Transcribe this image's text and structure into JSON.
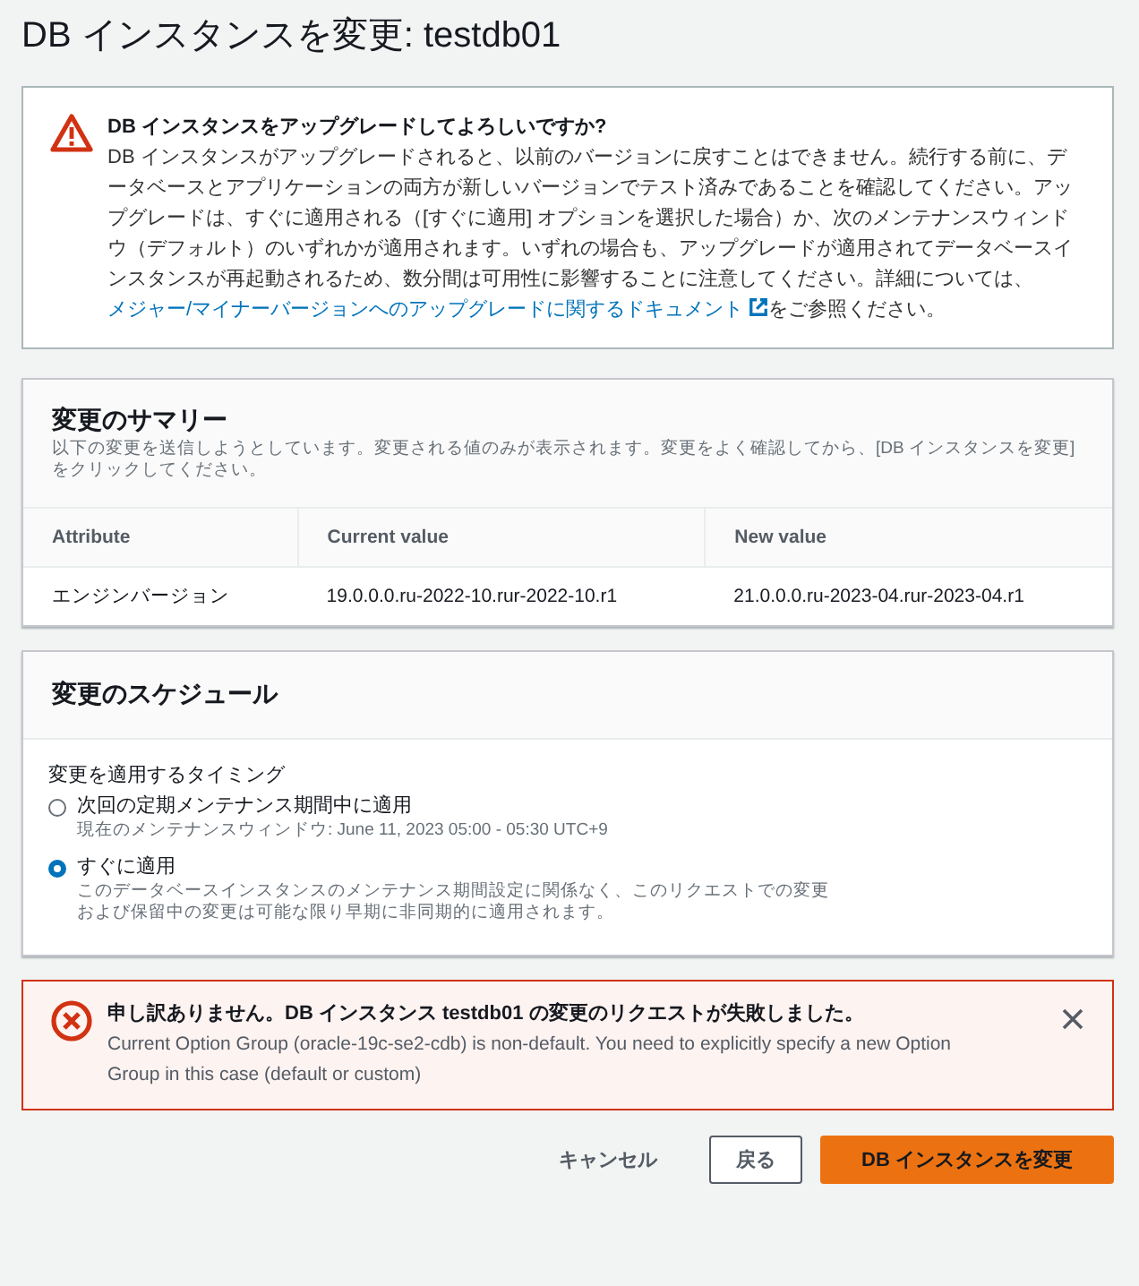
{
  "page_title": "DB インスタンスを変更: testdb01",
  "warning": {
    "title": "DB インスタンスをアップグレードしてよろしいですか?",
    "text_before": "DB インスタンスがアップグレードされると、以前のバージョンに戻すことはできません。続行する前に、データベースとアプリケーションの両方が新しいバージョンでテスト済みであることを確認してください。アップグレードは、すぐに適用される（[すぐに適用] オプションを選択した場合）か、次のメンテナンスウィンドウ（デフォルト）のいずれかが適用されます。いずれの場合も、アップグレードが適用されてデータベースインスタンスが再起動されるため、数分間は可用性に影響することに注意してください。詳細については、",
    "link": "メジャー/マイナーバージョンへのアップグレードに関するドキュメント",
    "text_after": "をご参照ください。"
  },
  "summary": {
    "title": "変更のサマリー",
    "description": "以下の変更を送信しようとしています。変更される値のみが表示されます。変更をよく確認してから、[DB インスタンスを変更] をクリックしてください。",
    "columns": [
      "Attribute",
      "Current value",
      "New value"
    ],
    "rows": [
      [
        "エンジンバージョン",
        "19.0.0.0.ru-2022-10.rur-2022-10.r1",
        "21.0.0.0.ru-2023-04.rur-2023-04.r1"
      ]
    ]
  },
  "schedule": {
    "title": "変更のスケジュール",
    "label": "変更を適用するタイミング",
    "options": [
      {
        "label": "次回の定期メンテナンス期間中に適用",
        "description": "現在のメンテナンスウィンドウ: June 11, 2023 05:00 - 05:30 UTC+9",
        "selected": false
      },
      {
        "label": "すぐに適用",
        "description": "このデータベースインスタンスのメンテナンス期間設定に関係なく、このリクエストでの変更および保留中の変更は可能な限り早期に非同期的に適用されます。",
        "selected": true
      }
    ]
  },
  "error": {
    "title": "申し訳ありません。DB インスタンス testdb01 の変更のリクエストが失敗しました。",
    "message": "Current Option Group (oracle-19c-se2-cdb) is non-default. You need to explicitly specify a new Option Group in this case (default or custom)"
  },
  "buttons": [
    {
      "label": "キャンセル",
      "kind": "link"
    },
    {
      "label": "戻る",
      "kind": "normal"
    },
    {
      "label": "DB インスタンスを変更",
      "kind": "primary"
    }
  ]
}
